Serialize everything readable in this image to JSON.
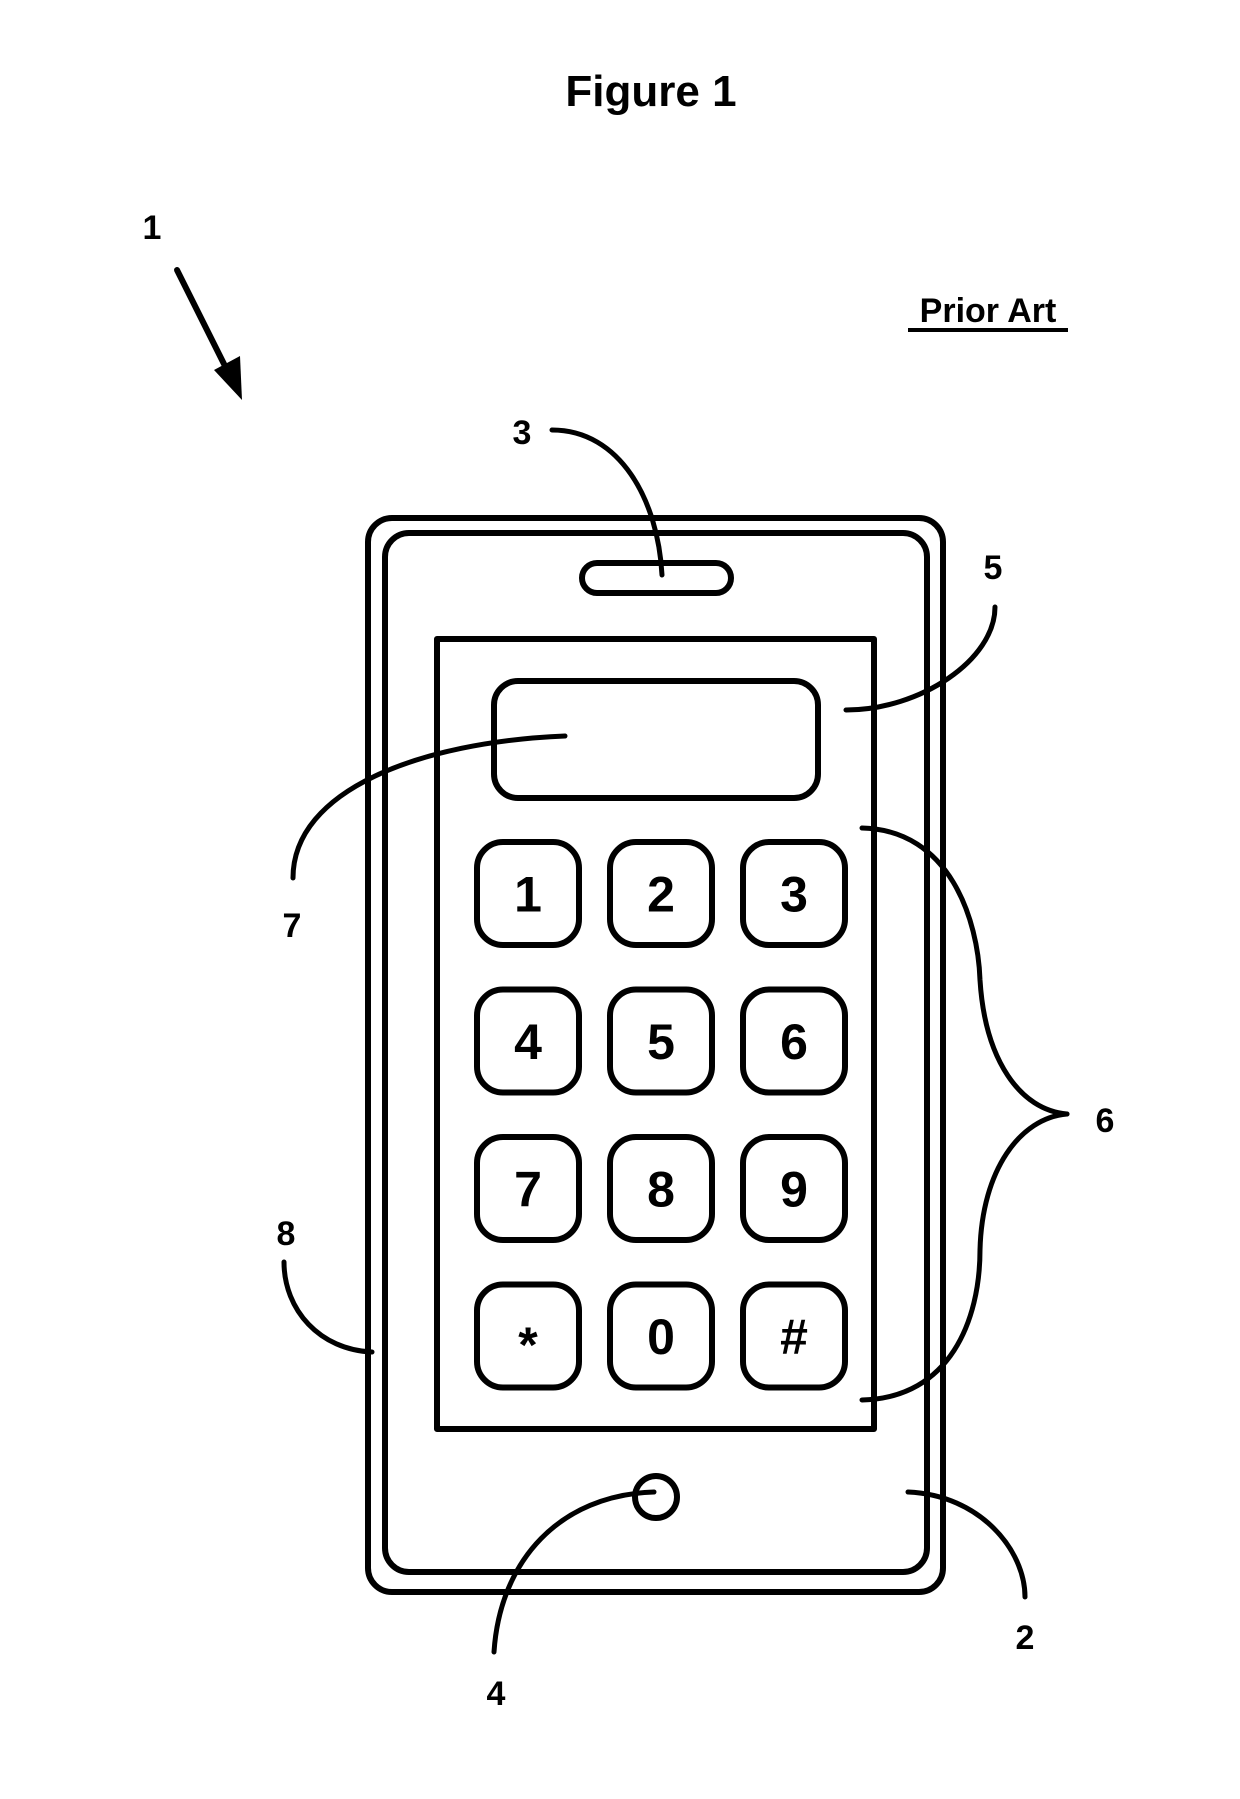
{
  "figure": {
    "title": "Figure 1",
    "note": "Prior Art"
  },
  "reference_numerals": {
    "device": "1",
    "housing": "2",
    "speaker": "3",
    "home_button": "4",
    "screen": "5",
    "keypad": "6",
    "display_field": "7",
    "bezel_edge": "8"
  },
  "keypad": {
    "keys": [
      "1",
      "2",
      "3",
      "4",
      "5",
      "6",
      "7",
      "8",
      "9",
      "*",
      "0",
      "#"
    ]
  },
  "colors": {
    "ink": "#000000",
    "paper": "#ffffff"
  }
}
